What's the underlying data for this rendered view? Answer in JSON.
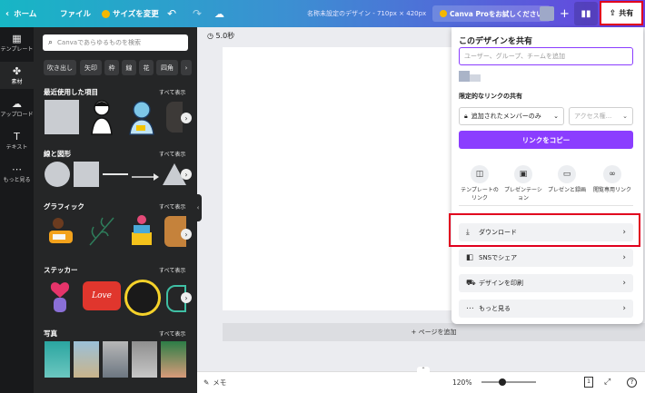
{
  "topbar": {
    "home": "ホーム",
    "file": "ファイル",
    "resize": "サイズを変更",
    "doc_title": "名称未設定のデザイン - 710px × 420px",
    "pro_button": "Canva Proをお試しください",
    "share": "共有",
    "icons": {
      "home": "chevron-left-icon",
      "resize": "crown-icon",
      "undo": "undo-icon",
      "redo": "redo-icon",
      "cloud": "cloud-icon",
      "plus": "plus-icon",
      "stats": "bar-chart-icon",
      "share": "share-upload-icon"
    }
  },
  "rail": [
    {
      "label": "テンプレート",
      "icon": "template-icon"
    },
    {
      "label": "素材",
      "icon": "shapes-icon"
    },
    {
      "label": "アップロード",
      "icon": "upload-icon"
    },
    {
      "label": "テキスト",
      "icon": "text-icon"
    },
    {
      "label": "もっと見る",
      "icon": "more-icon"
    }
  ],
  "panel": {
    "search_placeholder": "Canvaであらゆるものを検索",
    "chips": [
      "吹き出し",
      "矢印",
      "枠",
      "線",
      "花",
      "四角"
    ],
    "see_all": "すべて表示",
    "sections": [
      "最近使用した項目",
      "線と図形",
      "グラフィック",
      "ステッカー",
      "写真"
    ],
    "sticker_love": "Love"
  },
  "canvas": {
    "duration": "5.0秒",
    "add_page": "+ ページを追加"
  },
  "bottombar": {
    "notes": "メモ",
    "zoom": "120%",
    "zoom_level": 0.32,
    "page_count": "1",
    "help": "?"
  },
  "share_panel": {
    "title": "このデザインを共有",
    "invite_placeholder": "ユーザー、グループ、チームを追加",
    "limited_link_title": "限定的なリンクの共有",
    "access_value": "追加されたメンバーのみ",
    "permission_placeholder": "アクセス権...",
    "copy_link": "リンクをコピー",
    "options": [
      {
        "label": "テンプレートのリンク",
        "icon": "template-link-icon"
      },
      {
        "label": "プレゼンテーション",
        "icon": "presentation-icon"
      },
      {
        "label": "プレゼンと録画",
        "icon": "record-icon"
      },
      {
        "label": "閲覧専用リンク",
        "icon": "view-link-icon"
      }
    ],
    "actions": [
      {
        "label": "ダウンロード",
        "icon": "download-icon"
      },
      {
        "label": "SNSでシェア",
        "icon": "social-icon"
      },
      {
        "label": "デザインを印刷",
        "icon": "print-truck-icon"
      },
      {
        "label": "もっと見る",
        "icon": "ellipsis-icon"
      }
    ]
  },
  "colors": {
    "accent": "#8b3dff",
    "highlight": "#e1001e",
    "rail": "#18191b",
    "panel": "#252627",
    "canvas_bg": "#ebecf0"
  }
}
